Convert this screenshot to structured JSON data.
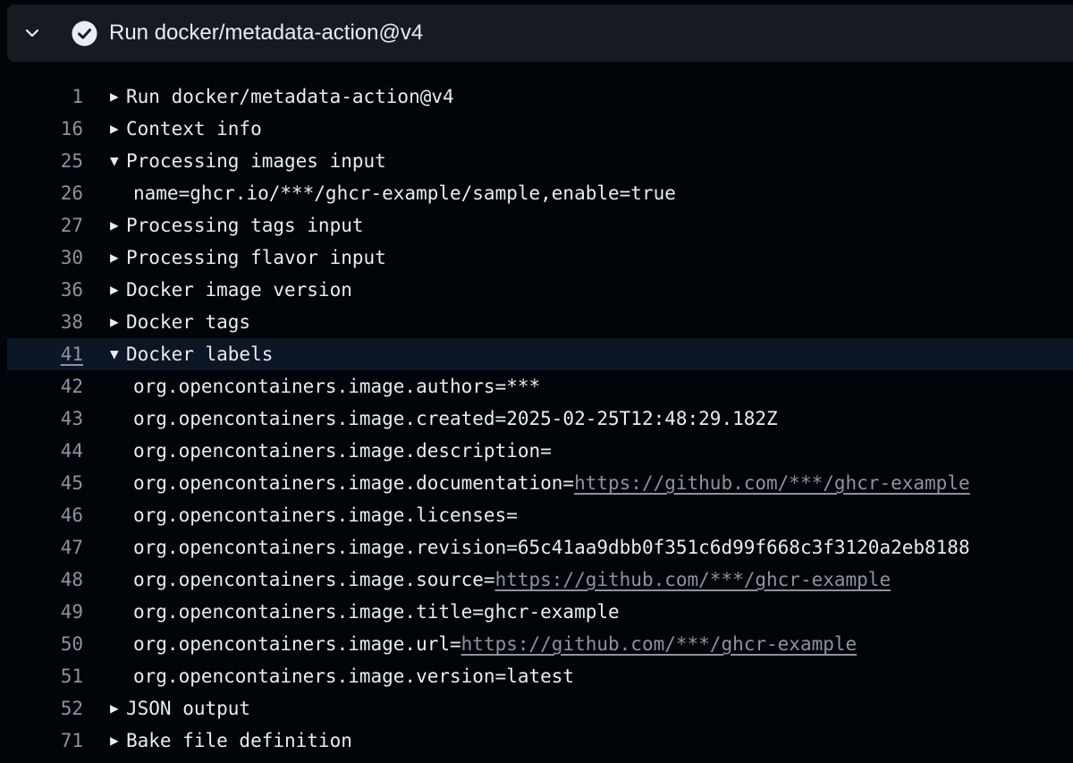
{
  "step": {
    "title": "Run docker/metadata-action@v4",
    "icons": {
      "toggle": "chevron-down-icon",
      "status": "check-circle-icon"
    },
    "colors": {
      "status": "#e6edf3",
      "panel": "#161b22",
      "background": "#010409"
    }
  },
  "log": {
    "lines": [
      {
        "num": "1",
        "kind": "group",
        "expanded": false,
        "text": "Run docker/metadata-action@v4"
      },
      {
        "num": "16",
        "kind": "group",
        "expanded": false,
        "text": "Context info"
      },
      {
        "num": "25",
        "kind": "group",
        "expanded": true,
        "text": "Processing images input"
      },
      {
        "num": "26",
        "kind": "text",
        "text": "name=ghcr.io/***/ghcr-example/sample,enable=true"
      },
      {
        "num": "27",
        "kind": "group",
        "expanded": false,
        "text": "Processing tags input"
      },
      {
        "num": "30",
        "kind": "group",
        "expanded": false,
        "text": "Processing flavor input"
      },
      {
        "num": "36",
        "kind": "group",
        "expanded": false,
        "text": "Docker image version"
      },
      {
        "num": "38",
        "kind": "group",
        "expanded": false,
        "text": "Docker tags"
      },
      {
        "num": "41",
        "kind": "group",
        "expanded": true,
        "selected": true,
        "text": "Docker labels"
      },
      {
        "num": "42",
        "kind": "text",
        "text": "org.opencontainers.image.authors=***"
      },
      {
        "num": "43",
        "kind": "text",
        "text": "org.opencontainers.image.created=2025-02-25T12:48:29.182Z"
      },
      {
        "num": "44",
        "kind": "text",
        "text": "org.opencontainers.image.description="
      },
      {
        "num": "45",
        "kind": "text",
        "text": "org.opencontainers.image.documentation=",
        "link": "https://github.com/***/ghcr-example"
      },
      {
        "num": "46",
        "kind": "text",
        "text": "org.opencontainers.image.licenses="
      },
      {
        "num": "47",
        "kind": "text",
        "text": "org.opencontainers.image.revision=65c41aa9dbb0f351c6d99f668c3f3120a2eb8188"
      },
      {
        "num": "48",
        "kind": "text",
        "text": "org.opencontainers.image.source=",
        "link": "https://github.com/***/ghcr-example"
      },
      {
        "num": "49",
        "kind": "text",
        "text": "org.opencontainers.image.title=ghcr-example"
      },
      {
        "num": "50",
        "kind": "text",
        "text": "org.opencontainers.image.url=",
        "link": "https://github.com/***/ghcr-example"
      },
      {
        "num": "51",
        "kind": "text",
        "text": "org.opencontainers.image.version=latest"
      },
      {
        "num": "52",
        "kind": "group",
        "expanded": false,
        "text": "JSON output"
      },
      {
        "num": "71",
        "kind": "group",
        "expanded": false,
        "text": "Bake file definition"
      }
    ]
  }
}
